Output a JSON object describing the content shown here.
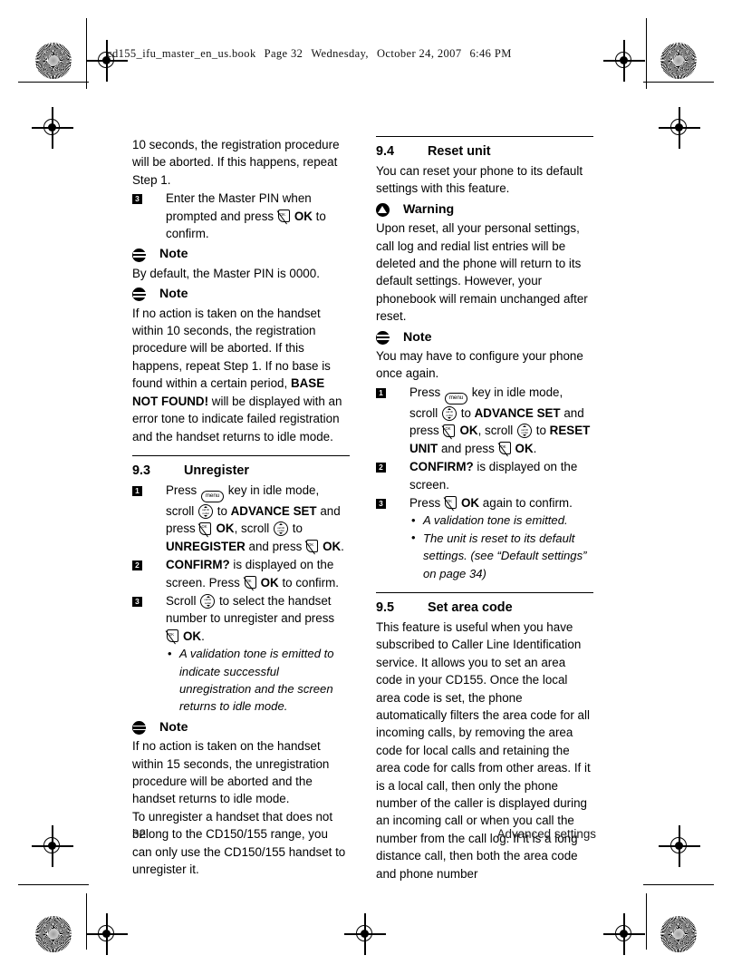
{
  "slug": {
    "filename": "cd155_ifu_master_en_us.book",
    "page_label": "Page 32",
    "weekday": "Wednesday,",
    "date": "October 24, 2007",
    "time": "6:46 PM"
  },
  "icons": {
    "menu_key": "menu",
    "nav_key_top": "call ID",
    "nav_key_bottom": "redial",
    "ok_key": "OK"
  },
  "left_column": {
    "intro_para": "10 seconds, the registration procedure will be aborted. If this happens, repeat Step 1.",
    "step3_number": "3",
    "step3_a": "Enter the Master PIN when prompted and press",
    "step3_ok": "OK",
    "step3_b": "to confirm.",
    "note1_title": "Note",
    "note1_body": "By default, the Master PIN is 0000.",
    "note2_title": "Note",
    "note2_line1": "If no action is taken on the handset within 10 seconds, the registration procedure will be aborted. If this happens, repeat Step 1. If no base is found within a certain period,",
    "note2_bold": "BASE NOT FOUND!",
    "note2_line2": "will be displayed with an error tone to indicate failed registration and the handset returns to idle mode.",
    "section": {
      "number": "9.3",
      "title": "Unregister"
    },
    "step1_number": "1",
    "step1_a": "Press",
    "step1_b": "key in idle mode, scroll",
    "step1_c": "to",
    "step1_menu1": "ADVANCE SET",
    "step1_d": "and press",
    "step1_ok1": "OK",
    "step1_e": ", scroll",
    "step1_f": "to",
    "step1_menu2": "UNREGISTER",
    "step1_g": "and press",
    "step1_ok2": "OK",
    "step1_h": ".",
    "step2_number": "2",
    "step2_prompt": "CONFIRM?",
    "step2_a": "is displayed on the screen. Press",
    "step2_ok": "OK",
    "step2_b": "to confirm.",
    "step3b_number": "3",
    "step3b_a": "Scroll",
    "step3b_b": "to select the handset number to unregister and press",
    "step3b_ok": "OK",
    "step3b_c": ".",
    "step3b_bullet": "A validation tone is emitted to indicate successful unregistration and the screen returns to idle mode.",
    "note3_title": "Note",
    "note3_body": "If no action is taken on the handset within 15 seconds, the unregistration procedure will be aborted and the handset returns to idle mode.",
    "closing_para": "To unregister a handset that does not belong to the CD150/155 range, you can only use the CD150/155 handset to unregister it."
  },
  "right_column": {
    "section94": {
      "number": "9.4",
      "title": "Reset unit"
    },
    "intro94": "You can reset your phone to its default settings with this feature.",
    "warning_title": "Warning",
    "warning_body": "Upon reset, all your personal settings, call log and redial list entries will be deleted and the phone will return to its default settings. However, your phonebook will remain unchanged after reset.",
    "note_title": "Note",
    "note_body": "You may have to configure your phone once again.",
    "step1_number": "1",
    "step1_a": "Press",
    "step1_b": "key in idle mode, scroll",
    "step1_c": "to",
    "step1_menu1": "ADVANCE SET",
    "step1_d": "and press",
    "step1_ok1": "OK",
    "step1_e": ", scroll",
    "step1_f": "to",
    "step1_menu2": "RESET UNIT",
    "step1_g": "and press",
    "step1_ok2": "OK",
    "step1_h": ".",
    "step2_number": "2",
    "step2_prompt": "CONFIRM?",
    "step2_a": "is displayed on the screen.",
    "step3_number": "3",
    "step3_a": "Press",
    "step3_ok": "OK",
    "step3_b": "again to confirm.",
    "step3_bullet1": "A validation tone is emitted.",
    "step3_bullet2": "The unit is reset to its default settings. (see “Default settings” on page 34)",
    "section95": {
      "number": "9.5",
      "title": "Set area code"
    },
    "body95": "This feature is useful when you have subscribed to Caller Line Identification service. It allows you to set an area code in your CD155. Once the local area code is set, the phone automatically filters the area code for all incoming calls, by removing the area code for local calls and retaining the area code for calls from other areas. If it is a local call, then only the phone number of the caller is displayed during an incoming call or when you call the number from the call log. If it is a long distance call, then both the area code and phone number"
  },
  "footer": {
    "page_number": "32",
    "section_name": "Advanced settings"
  }
}
